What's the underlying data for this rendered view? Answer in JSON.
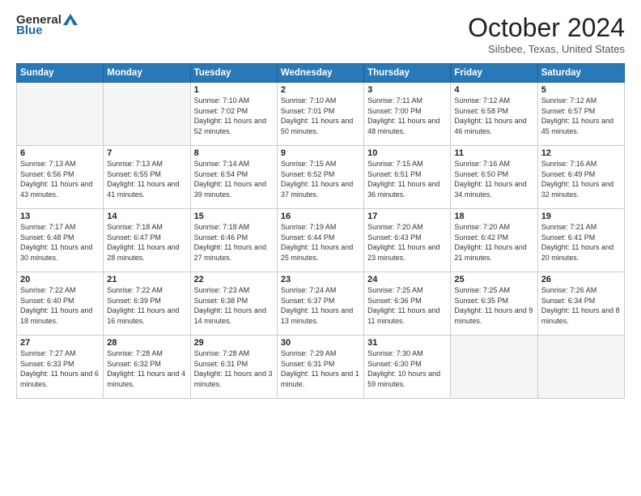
{
  "header": {
    "logo_general": "General",
    "logo_blue": "Blue",
    "month": "October 2024",
    "location": "Silsbee, Texas, United States"
  },
  "days_of_week": [
    "Sunday",
    "Monday",
    "Tuesday",
    "Wednesday",
    "Thursday",
    "Friday",
    "Saturday"
  ],
  "weeks": [
    [
      {
        "day": "",
        "empty": true
      },
      {
        "day": "",
        "empty": true
      },
      {
        "day": "1",
        "sunrise": "Sunrise: 7:10 AM",
        "sunset": "Sunset: 7:02 PM",
        "daylight": "Daylight: 11 hours and 52 minutes."
      },
      {
        "day": "2",
        "sunrise": "Sunrise: 7:10 AM",
        "sunset": "Sunset: 7:01 PM",
        "daylight": "Daylight: 11 hours and 50 minutes."
      },
      {
        "day": "3",
        "sunrise": "Sunrise: 7:11 AM",
        "sunset": "Sunset: 7:00 PM",
        "daylight": "Daylight: 11 hours and 48 minutes."
      },
      {
        "day": "4",
        "sunrise": "Sunrise: 7:12 AM",
        "sunset": "Sunset: 6:58 PM",
        "daylight": "Daylight: 11 hours and 46 minutes."
      },
      {
        "day": "5",
        "sunrise": "Sunrise: 7:12 AM",
        "sunset": "Sunset: 6:57 PM",
        "daylight": "Daylight: 11 hours and 45 minutes."
      }
    ],
    [
      {
        "day": "6",
        "sunrise": "Sunrise: 7:13 AM",
        "sunset": "Sunset: 6:56 PM",
        "daylight": "Daylight: 11 hours and 43 minutes."
      },
      {
        "day": "7",
        "sunrise": "Sunrise: 7:13 AM",
        "sunset": "Sunset: 6:55 PM",
        "daylight": "Daylight: 11 hours and 41 minutes."
      },
      {
        "day": "8",
        "sunrise": "Sunrise: 7:14 AM",
        "sunset": "Sunset: 6:54 PM",
        "daylight": "Daylight: 11 hours and 39 minutes."
      },
      {
        "day": "9",
        "sunrise": "Sunrise: 7:15 AM",
        "sunset": "Sunset: 6:52 PM",
        "daylight": "Daylight: 11 hours and 37 minutes."
      },
      {
        "day": "10",
        "sunrise": "Sunrise: 7:15 AM",
        "sunset": "Sunset: 6:51 PM",
        "daylight": "Daylight: 11 hours and 36 minutes."
      },
      {
        "day": "11",
        "sunrise": "Sunrise: 7:16 AM",
        "sunset": "Sunset: 6:50 PM",
        "daylight": "Daylight: 11 hours and 34 minutes."
      },
      {
        "day": "12",
        "sunrise": "Sunrise: 7:16 AM",
        "sunset": "Sunset: 6:49 PM",
        "daylight": "Daylight: 11 hours and 32 minutes."
      }
    ],
    [
      {
        "day": "13",
        "sunrise": "Sunrise: 7:17 AM",
        "sunset": "Sunset: 6:48 PM",
        "daylight": "Daylight: 11 hours and 30 minutes."
      },
      {
        "day": "14",
        "sunrise": "Sunrise: 7:18 AM",
        "sunset": "Sunset: 6:47 PM",
        "daylight": "Daylight: 11 hours and 28 minutes."
      },
      {
        "day": "15",
        "sunrise": "Sunrise: 7:18 AM",
        "sunset": "Sunset: 6:46 PM",
        "daylight": "Daylight: 11 hours and 27 minutes."
      },
      {
        "day": "16",
        "sunrise": "Sunrise: 7:19 AM",
        "sunset": "Sunset: 6:44 PM",
        "daylight": "Daylight: 11 hours and 25 minutes."
      },
      {
        "day": "17",
        "sunrise": "Sunrise: 7:20 AM",
        "sunset": "Sunset: 6:43 PM",
        "daylight": "Daylight: 11 hours and 23 minutes."
      },
      {
        "day": "18",
        "sunrise": "Sunrise: 7:20 AM",
        "sunset": "Sunset: 6:42 PM",
        "daylight": "Daylight: 11 hours and 21 minutes."
      },
      {
        "day": "19",
        "sunrise": "Sunrise: 7:21 AM",
        "sunset": "Sunset: 6:41 PM",
        "daylight": "Daylight: 11 hours and 20 minutes."
      }
    ],
    [
      {
        "day": "20",
        "sunrise": "Sunrise: 7:22 AM",
        "sunset": "Sunset: 6:40 PM",
        "daylight": "Daylight: 11 hours and 18 minutes."
      },
      {
        "day": "21",
        "sunrise": "Sunrise: 7:22 AM",
        "sunset": "Sunset: 6:39 PM",
        "daylight": "Daylight: 11 hours and 16 minutes."
      },
      {
        "day": "22",
        "sunrise": "Sunrise: 7:23 AM",
        "sunset": "Sunset: 6:38 PM",
        "daylight": "Daylight: 11 hours and 14 minutes."
      },
      {
        "day": "23",
        "sunrise": "Sunrise: 7:24 AM",
        "sunset": "Sunset: 6:37 PM",
        "daylight": "Daylight: 11 hours and 13 minutes."
      },
      {
        "day": "24",
        "sunrise": "Sunrise: 7:25 AM",
        "sunset": "Sunset: 6:36 PM",
        "daylight": "Daylight: 11 hours and 11 minutes."
      },
      {
        "day": "25",
        "sunrise": "Sunrise: 7:25 AM",
        "sunset": "Sunset: 6:35 PM",
        "daylight": "Daylight: 11 hours and 9 minutes."
      },
      {
        "day": "26",
        "sunrise": "Sunrise: 7:26 AM",
        "sunset": "Sunset: 6:34 PM",
        "daylight": "Daylight: 11 hours and 8 minutes."
      }
    ],
    [
      {
        "day": "27",
        "sunrise": "Sunrise: 7:27 AM",
        "sunset": "Sunset: 6:33 PM",
        "daylight": "Daylight: 11 hours and 6 minutes."
      },
      {
        "day": "28",
        "sunrise": "Sunrise: 7:28 AM",
        "sunset": "Sunset: 6:32 PM",
        "daylight": "Daylight: 11 hours and 4 minutes."
      },
      {
        "day": "29",
        "sunrise": "Sunrise: 7:28 AM",
        "sunset": "Sunset: 6:31 PM",
        "daylight": "Daylight: 11 hours and 3 minutes."
      },
      {
        "day": "30",
        "sunrise": "Sunrise: 7:29 AM",
        "sunset": "Sunset: 6:31 PM",
        "daylight": "Daylight: 11 hours and 1 minute."
      },
      {
        "day": "31",
        "sunrise": "Sunrise: 7:30 AM",
        "sunset": "Sunset: 6:30 PM",
        "daylight": "Daylight: 10 hours and 59 minutes."
      },
      {
        "day": "",
        "empty": true
      },
      {
        "day": "",
        "empty": true
      }
    ]
  ]
}
